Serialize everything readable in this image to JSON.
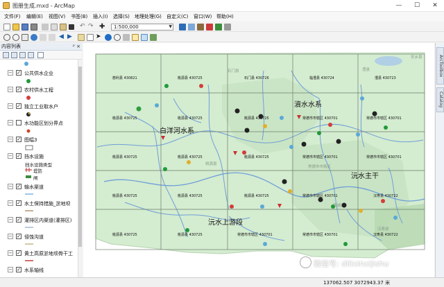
{
  "window": {
    "title": "图册生成.mxd - ArcMap",
    "min": "—",
    "max": "☐",
    "close": "✕"
  },
  "menus": [
    "文件(F)",
    "编辑(E)",
    "视图(V)",
    "书签(B)",
    "插入(I)",
    "选择(S)",
    "地理处理(G)",
    "自定义(C)",
    "窗口(W)",
    "帮助(H)"
  ],
  "toolbar": {
    "scale": "1:500,000"
  },
  "toc": {
    "title": "内容列表",
    "pin": "ᵖ",
    "close": "×",
    "layers": [
      {
        "name": "公共供水企业",
        "checked": true
      },
      {
        "name": "农村供水工程",
        "checked": true
      },
      {
        "name": "独立工业取水户",
        "checked": true
      },
      {
        "name": "水功能区划分界点",
        "checked": true
      },
      {
        "name": "图幅3",
        "checked": true
      },
      {
        "name": "挡水设施",
        "checked": true
      },
      {
        "name": "输水渠道",
        "checked": true
      },
      {
        "name": "水土保持措施_淤地坝",
        "checked": true
      },
      {
        "name": "灌排区内渠道(灌排区)",
        "checked": true
      },
      {
        "name": "侵蚀沟道",
        "checked": true
      },
      {
        "name": "黄土高原淤地坝骨干工",
        "checked": true
      },
      {
        "name": "水系轴线",
        "checked": true
      }
    ],
    "sublegend": {
      "header": "挡水设施类型",
      "items": [
        "堤防",
        "闸"
      ]
    }
  },
  "map": {
    "sheets": [
      {
        "label": "慈利县 430821"
      },
      {
        "label": "桃源县 430725"
      },
      {
        "label": "石门县 430726"
      },
      {
        "label": "临澧县 430724"
      },
      {
        "label": "澧县 430723"
      },
      {
        "label": "桃源县 430725"
      },
      {
        "label": "桃源县 430725"
      },
      {
        "label": "桃源县 430725"
      },
      {
        "label": "常德市市辖区 430701"
      },
      {
        "label": "常德市市辖区 430701"
      },
      {
        "label": "桃源县 430725"
      },
      {
        "label": "桃源县 430725"
      },
      {
        "label": "桃源县 430725"
      },
      {
        "label": "常德市市辖区 430701"
      },
      {
        "label": "常德市市辖区 430701"
      },
      {
        "label": "桃源县 430725"
      },
      {
        "label": "桃源县 430725"
      },
      {
        "label": "桃源县 430725"
      },
      {
        "label": "常德市市辖区 430701"
      },
      {
        "label": "汉寿县 430722"
      },
      {
        "label": "桃源县 430725"
      },
      {
        "label": "桃源县 430725"
      },
      {
        "label": "常德市市辖区 430701"
      },
      {
        "label": "常德市市辖区 430701"
      },
      {
        "label": "汉寿县 430722"
      }
    ],
    "big_labels": [
      "白洋河水系",
      "澬水水系",
      "沅水主干",
      "沅水上游段"
    ],
    "small_labels": [
      "安乡县",
      "澧县",
      "石门县",
      "桃源县",
      "常德市市辖区",
      "汉寿县",
      "鼎城区"
    ]
  },
  "dock": {
    "tabs": [
      "ArcToolbox",
      "Catalog"
    ]
  },
  "status": {
    "coords": "137062.507  3072943.37 米"
  },
  "watermark": {
    "text": "微信号: dilixinxijishu"
  },
  "colors": {
    "map_fill": "#d4ecd0",
    "river": "#5f8fd0",
    "grid": "#7f8f7f"
  }
}
